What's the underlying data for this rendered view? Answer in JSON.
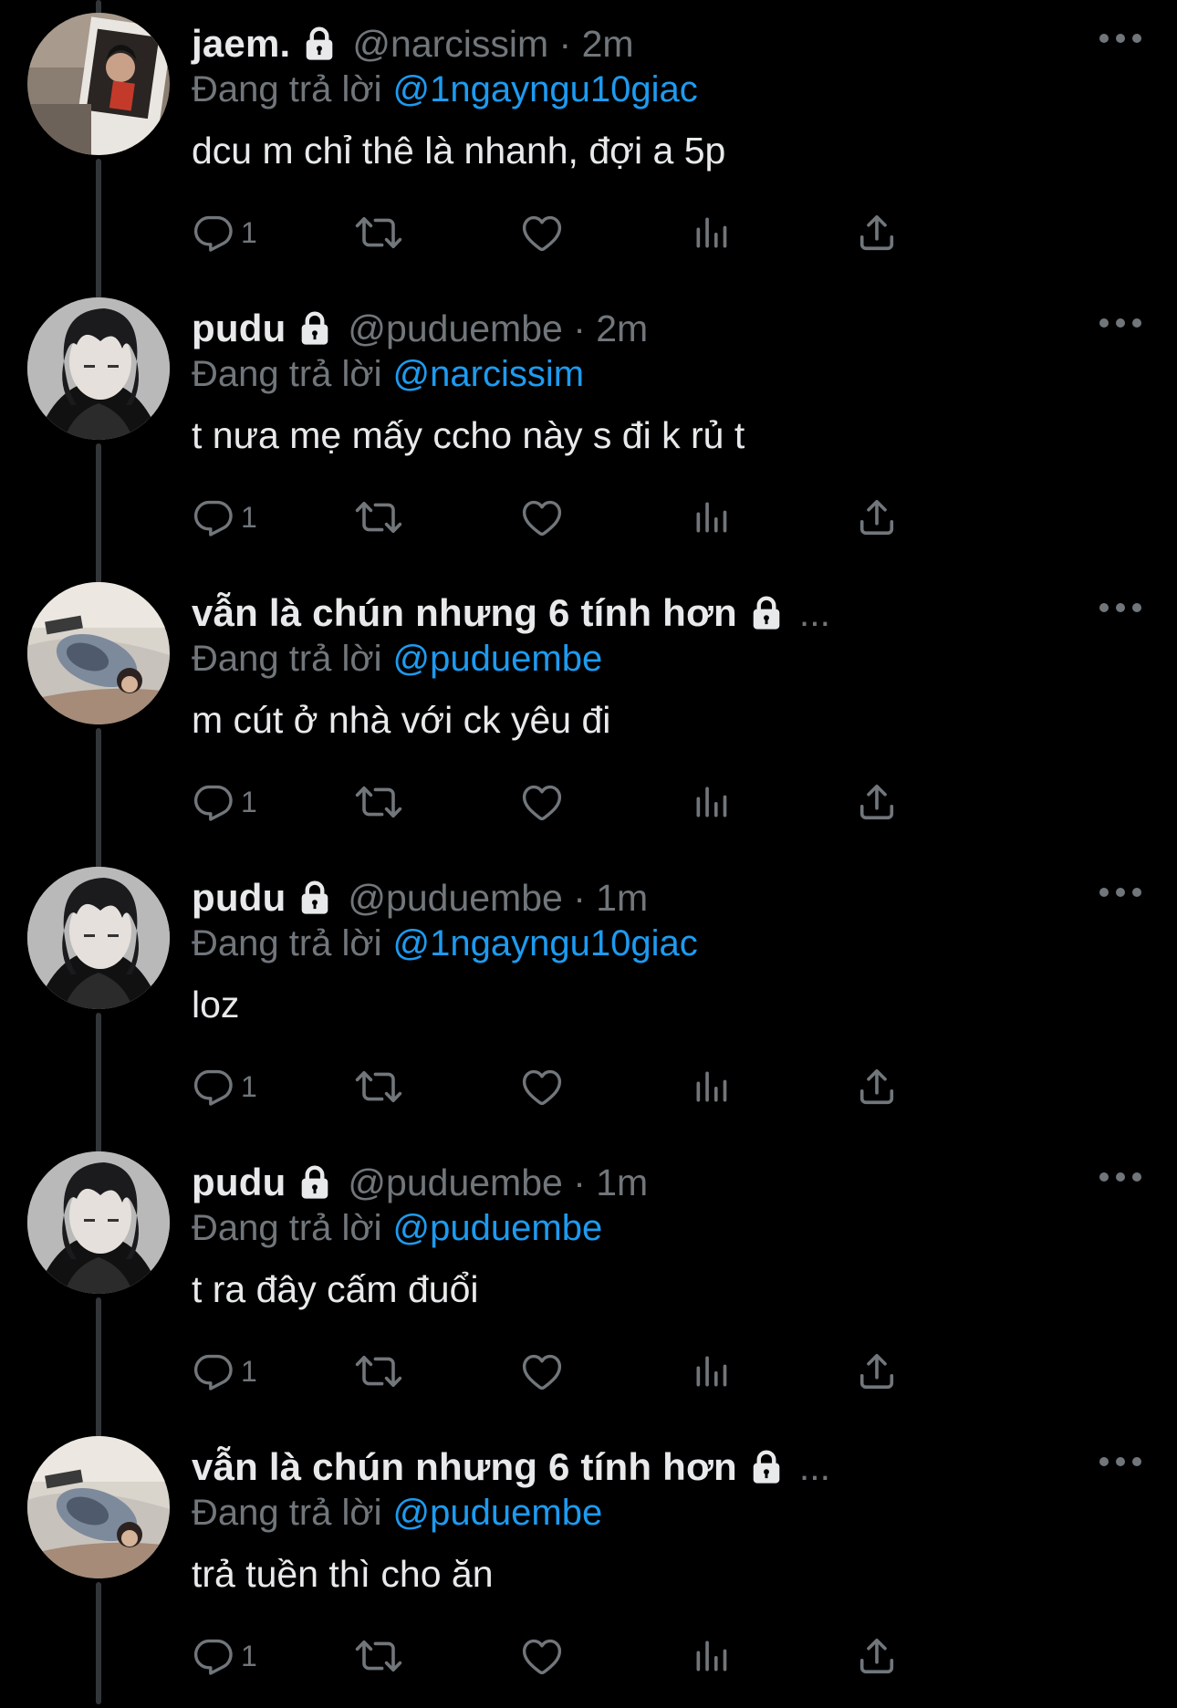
{
  "colors": {
    "background": "#000000",
    "primary_text": "#e7e9ea",
    "secondary_text": "#71767b",
    "mention": "#1d9bf0",
    "thread_line": "#333639"
  },
  "icons": {
    "protected": "lock-icon",
    "more": "more-icon",
    "reply": "reply-icon",
    "retweet": "retweet-icon",
    "like": "heart-icon",
    "views": "views-icon",
    "share": "share-icon"
  },
  "tweets": [
    {
      "name": "jaem.",
      "meta": "@narcissim · 2m",
      "name_ellipsis": "",
      "reply_prefix": "Đang trả lời",
      "reply_to": "@1ngayngu10giac",
      "text": "dcu m chỉ thê là nhanh, đợi a 5p",
      "reply_count": "1",
      "avatar": "avatar-jaem"
    },
    {
      "name": "pudu",
      "meta": "@puduembe · 2m",
      "name_ellipsis": "",
      "reply_prefix": "Đang trả lời",
      "reply_to": "@narcissim",
      "text": "t nưa mẹ mấy ccho này s đi k rủ t",
      "reply_count": "1",
      "avatar": "avatar-pudu"
    },
    {
      "name": "vẫn là chún nhưng 6 tính hơn",
      "meta": "",
      "name_ellipsis": "...",
      "reply_prefix": "Đang trả lời",
      "reply_to": "@puduembe",
      "text": "m cút ở nhà với ck yêu đi",
      "reply_count": "1",
      "avatar": "avatar-chun"
    },
    {
      "name": "pudu",
      "meta": "@puduembe · 1m",
      "name_ellipsis": "",
      "reply_prefix": "Đang trả lời",
      "reply_to": "@1ngayngu10giac",
      "text": "loz",
      "reply_count": "1",
      "avatar": "avatar-pudu"
    },
    {
      "name": "pudu",
      "meta": "@puduembe · 1m",
      "name_ellipsis": "",
      "reply_prefix": "Đang trả lời",
      "reply_to": "@puduembe",
      "text": "t ra đây cấm đuổi",
      "reply_count": "1",
      "avatar": "avatar-pudu"
    },
    {
      "name": "vẫn là chún nhưng 6 tính hơn",
      "meta": "",
      "name_ellipsis": "...",
      "reply_prefix": "Đang trả lời",
      "reply_to": "@puduembe",
      "text": "trả tuền thì cho ăn",
      "reply_count": "1",
      "avatar": "avatar-chun"
    }
  ]
}
